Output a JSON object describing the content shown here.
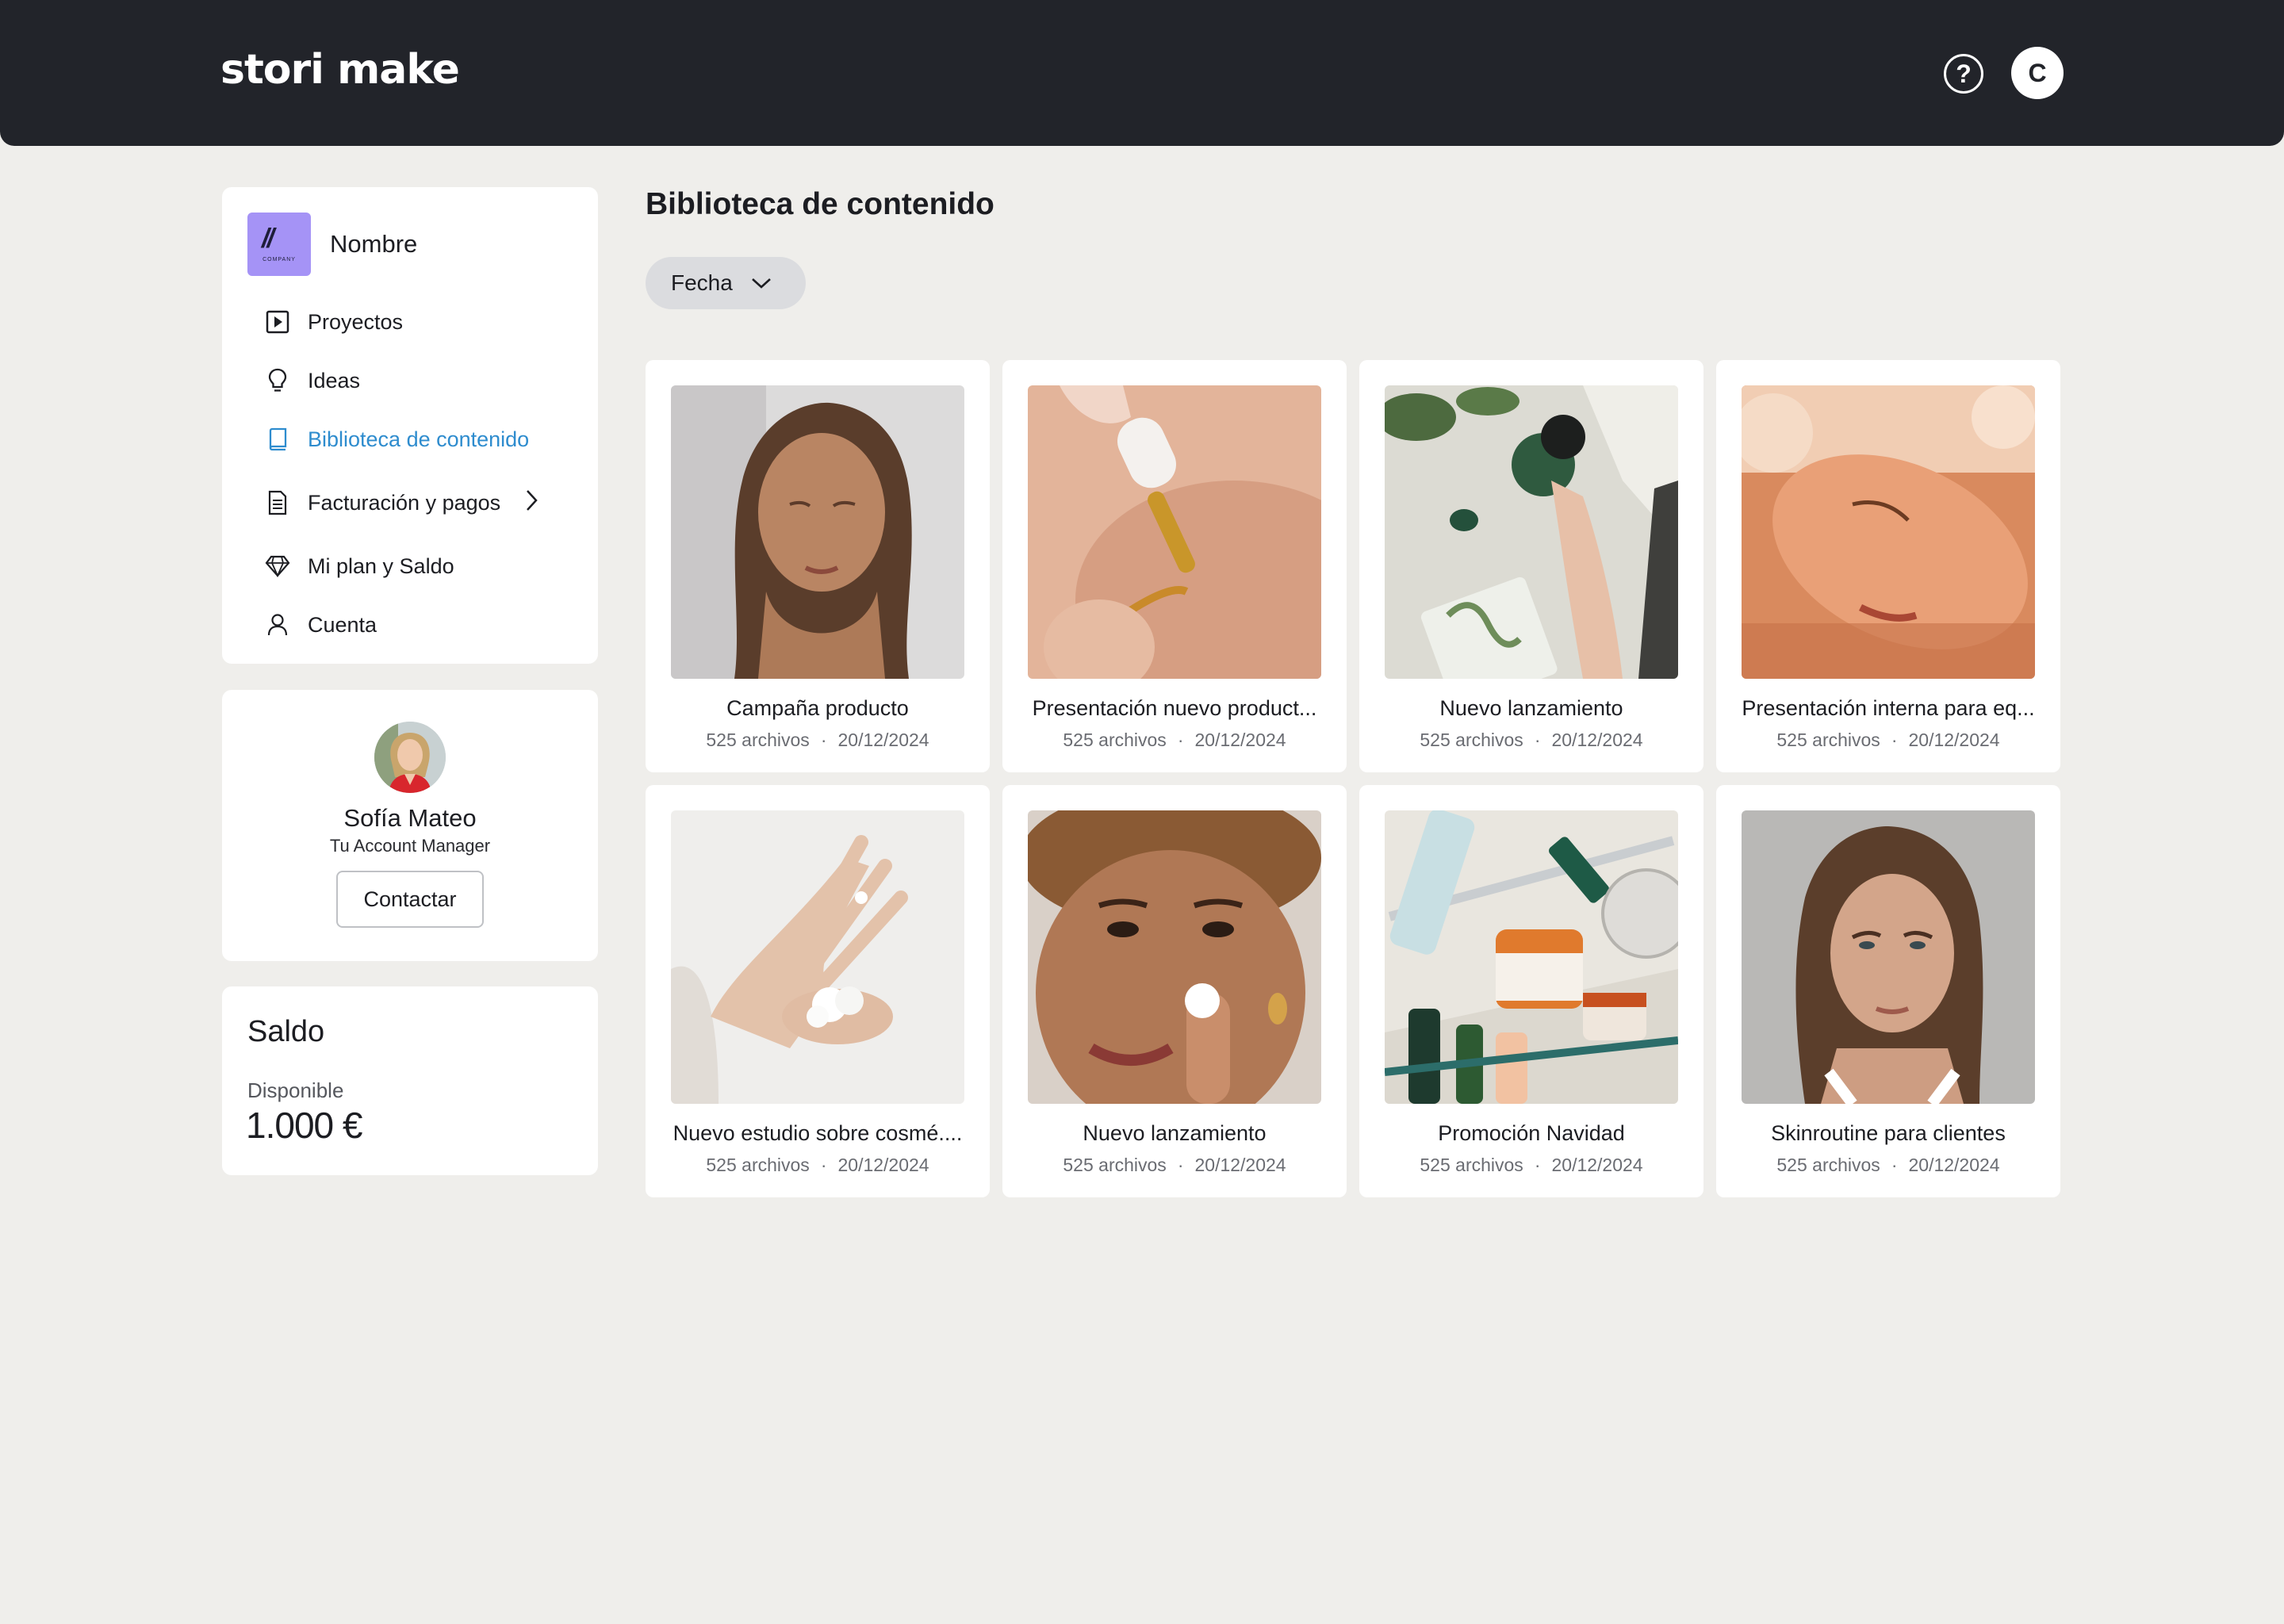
{
  "header": {
    "logo": "stori make",
    "help_icon_glyph": "?",
    "user_initial": "C"
  },
  "sidebar": {
    "company_name": "Nombre",
    "company_logo_text": "COMPANY",
    "items": [
      {
        "label": "Proyectos",
        "icon": "play-square-icon"
      },
      {
        "label": "Ideas",
        "icon": "lightbulb-icon"
      },
      {
        "label": "Biblioteca de contenido",
        "icon": "book-icon",
        "active": true
      },
      {
        "label": "Facturación y pagos",
        "icon": "invoice-icon",
        "has_submenu": true
      },
      {
        "label": "Mi plan y Saldo",
        "icon": "diamond-icon"
      },
      {
        "label": "Cuenta",
        "icon": "user-icon"
      }
    ]
  },
  "account_manager": {
    "name": "Sofía Mateo",
    "role": "Tu Account Manager",
    "button": "Contactar"
  },
  "saldo": {
    "title": "Saldo",
    "label": "Disponible",
    "value": "1.000 €"
  },
  "main": {
    "title": "Biblioteca de contenido",
    "filter": "Fecha",
    "tiles": [
      {
        "title": "Campaña producto",
        "files": "525 archivos",
        "date": "20/12/2024"
      },
      {
        "title": "Presentación nuevo product...",
        "files": "525 archivos",
        "date": "20/12/2024"
      },
      {
        "title": "Nuevo lanzamiento",
        "files": "525 archivos",
        "date": "20/12/2024"
      },
      {
        "title": "Presentación interna para eq...",
        "files": "525 archivos",
        "date": "20/12/2024"
      },
      {
        "title": "Nuevo estudio sobre cosmé....",
        "files": "525 archivos",
        "date": "20/12/2024"
      },
      {
        "title": "Nuevo lanzamiento",
        "files": "525 archivos",
        "date": "20/12/2024"
      },
      {
        "title": "Promoción Navidad",
        "files": "525 archivos",
        "date": "20/12/2024"
      },
      {
        "title": "Skinroutine para clientes",
        "files": "525 archivos",
        "date": "20/12/2024"
      }
    ]
  },
  "colors": {
    "header_bg": "#22242a",
    "page_bg": "#efeeeb",
    "active_nav": "#2e8cce",
    "company_logo_bg": "#a593f6",
    "filter_bg": "#dbdcdf"
  }
}
